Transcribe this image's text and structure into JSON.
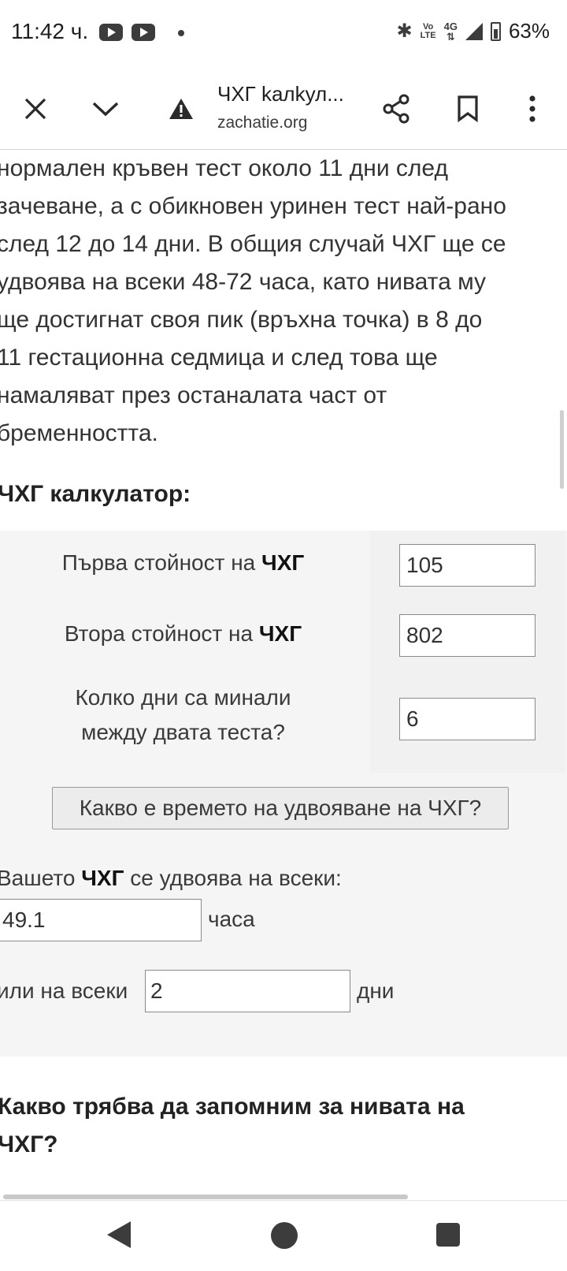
{
  "status_bar": {
    "time": "11:42 ч.",
    "volte_line1": "Vo",
    "volte_line2": "LTE",
    "network": "4G",
    "battery": "63%"
  },
  "toolbar": {
    "title": "ЧХГ kалkул...",
    "domain": "zachatie.org",
    "icons": [
      "close-icon",
      "chevron-down-icon",
      "warning-icon",
      "share-icon",
      "bookmark-icon",
      "more-vert-icon"
    ]
  },
  "article": {
    "paragraph_lines": [
      "нормален кръвен тест около 11 дни след",
      "зачеване, а с обикновен уринен тест най-рано",
      "след 12 до 14 дни. В общия случай ЧХГ ще се",
      "удвоява на всеки 48-72 часа, като нивата му",
      "ще достигнат своя пик (връхна точка) в 8 до",
      "11 гестационна седмица и след това ще",
      "намаляват през останалата част от",
      "бременността."
    ],
    "section_heading": "ЧХГ калкулатор:",
    "next_heading_line1": "Какво трябва да запомним за нивата на",
    "next_heading_line2": "ЧХГ?"
  },
  "calculator": {
    "first_label_prefix": "Първа стойност на ",
    "first_label_bold": "ЧХГ",
    "first_value": "105",
    "second_label_prefix": "Втора стойност на ",
    "second_label_bold": "ЧХГ",
    "second_value": "802",
    "days_label_line1": "Колко дни са минали",
    "days_label_line2": "между двата теста?",
    "days_value": "6",
    "button_label": "Какво е времето на удвояване на ЧХГ?",
    "result_prefix": "Вашето ",
    "result_bold": "ЧХГ",
    "result_suffix": " се удвоява на всеки:",
    "hours_value": "49.1",
    "hours_unit": "часа",
    "or_every": "или на всеки",
    "days_result_value": "2",
    "days_unit": "дни"
  }
}
